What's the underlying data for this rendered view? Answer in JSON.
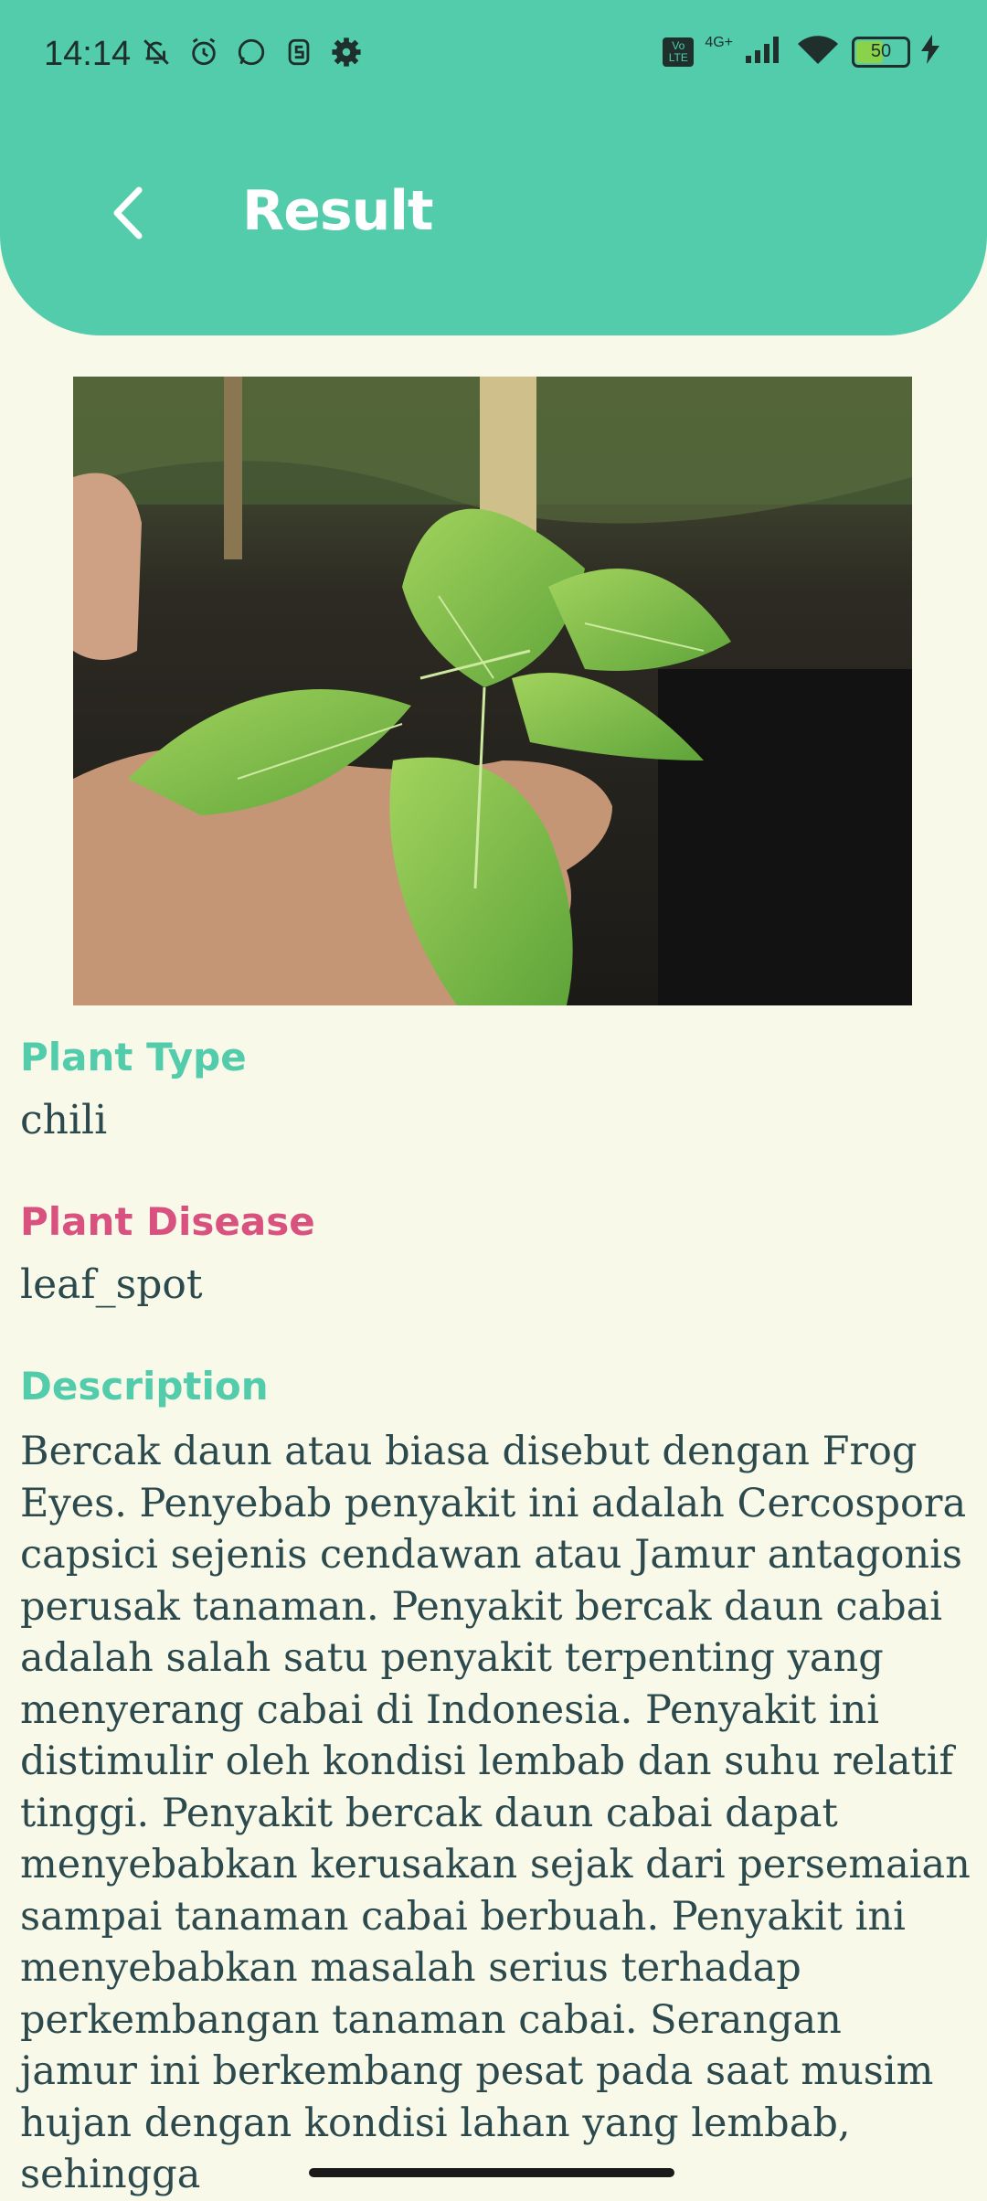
{
  "status_bar": {
    "time": "14:14",
    "network": "4G+",
    "volte": "Vo LTE",
    "battery": "50",
    "battery_level": 0.5
  },
  "header": {
    "title": "Result",
    "back_icon": "chevron-left-icon",
    "color": "#52ccab"
  },
  "result": {
    "image_icon": "plant-photo",
    "plant_type_label": "Plant Type",
    "plant_type_value": "chili",
    "plant_disease_label": "Plant Disease",
    "plant_disease_value": "leaf_spot",
    "description_label": "Description",
    "description_text": "Bercak daun atau biasa disebut dengan Frog Eyes. Penyebab penyakit ini adalah Cercospora capsici sejenis cendawan atau Jamur antagonis perusak tanaman. Penyakit bercak daun cabai adalah salah satu penyakit terpenting yang menyerang cabai di Indonesia. Penyakit ini distimulir oleh kondisi lembab dan suhu relatif tinggi. Penyakit bercak daun cabai dapat menyebabkan kerusakan sejak dari persemaian sampai tanaman cabai berbuah. Penyakit ini menyebabkan masalah serius terhadap perkembangan tanaman cabai. Serangan jamur ini berkembang pesat pada saat musim hujan dengan kondisi lahan yang lembab, sehingga"
  },
  "colors": {
    "accent_teal": "#52ccab",
    "disease_pink": "#d9527f",
    "text_dark": "#2c4a4d",
    "background": "#f8f9e9"
  }
}
